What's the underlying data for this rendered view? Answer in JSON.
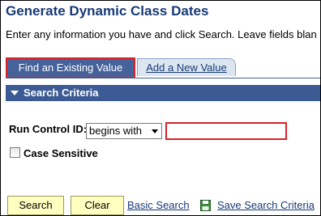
{
  "page": {
    "title": "Generate Dynamic Class Dates",
    "instructions": "Enter any information you have and click Search. Leave fields blan"
  },
  "tabs": [
    {
      "label": "Find an Existing Value",
      "active": true
    },
    {
      "label": "Add a New Value",
      "active": false
    }
  ],
  "search_criteria": {
    "header": "Search Criteria",
    "run_control": {
      "label": "Run Control ID:",
      "operator": "begins with",
      "value": ""
    },
    "case_sensitive": {
      "label": "Case Sensitive",
      "checked": false
    }
  },
  "actions": {
    "search_label": "Search",
    "clear_label": "Clear",
    "basic_search_label": "Basic Search",
    "save_search_label": "Save Search Criteria"
  },
  "icons": {
    "save": "floppy-disk-icon",
    "collapse": "triangle-down-icon",
    "dropdown": "chevron-down-icon"
  },
  "colors": {
    "title": "#173a75",
    "tab_active_bg": "#46629b",
    "highlight_border": "#d8222a",
    "section_bar": "#3c5a94",
    "button_bg": "#ffffc0",
    "link": "#173a75"
  }
}
